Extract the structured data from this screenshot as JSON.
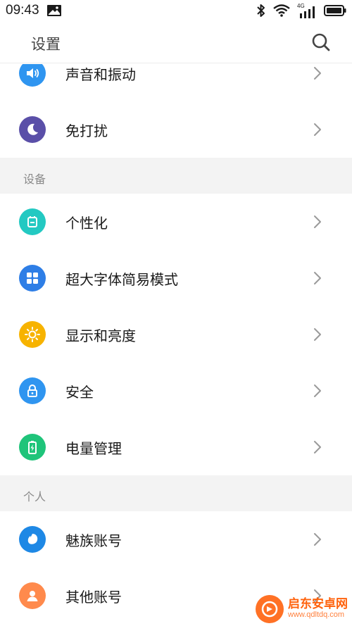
{
  "status": {
    "time": "09:43",
    "network": "4G"
  },
  "header": {
    "title": "设置"
  },
  "rows": {
    "sound": {
      "label": "声音和振动",
      "color": "#2f95f0"
    },
    "dnd": {
      "label": "免打扰",
      "color": "#5a4fa8"
    },
    "personalize": {
      "label": "个性化",
      "color": "#23c9c2"
    },
    "large_font": {
      "label": "超大字体简易模式",
      "color": "#2e7ee6"
    },
    "display": {
      "label": "显示和亮度",
      "color": "#f7b300"
    },
    "security": {
      "label": "安全",
      "color": "#2f95f0"
    },
    "battery": {
      "label": "电量管理",
      "color": "#1fc47a"
    },
    "meizu_account": {
      "label": "魅族账号",
      "color": "#1e88e5"
    },
    "other_accounts": {
      "label": "其他账号",
      "color": "#ff8a4c"
    }
  },
  "sections": {
    "device": "设备",
    "personal": "个人"
  },
  "watermark": {
    "text": "启东安卓网",
    "url": "www.qdltdq.com"
  }
}
